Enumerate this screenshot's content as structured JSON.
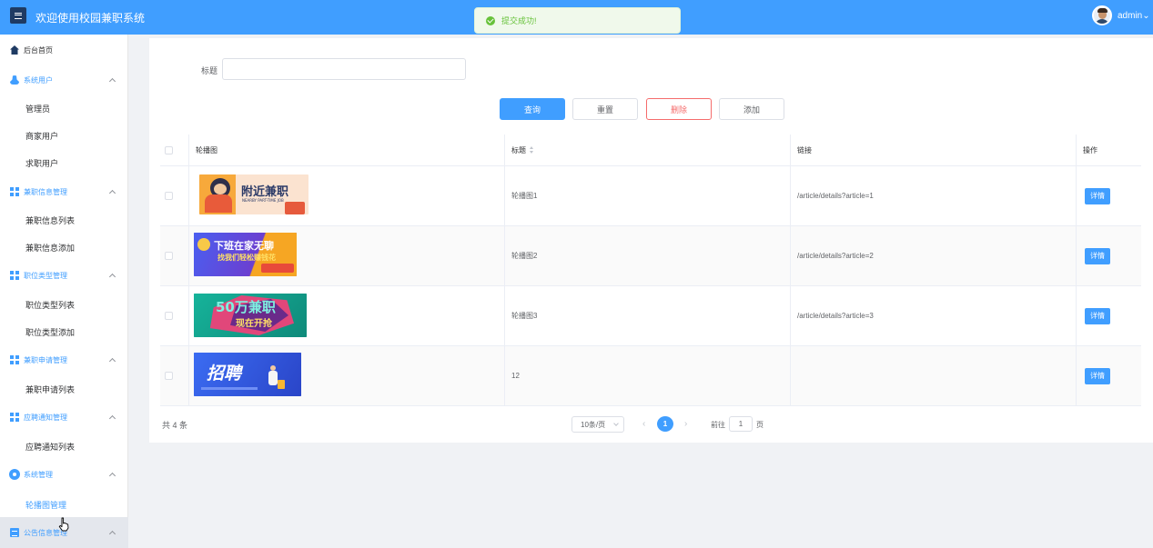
{
  "header": {
    "title": "欢迎使用校园兼职系统",
    "username": "admin",
    "username_caret": "⌄"
  },
  "toast": {
    "message": "提交成功!"
  },
  "sidebar": {
    "home": "后台首页",
    "groups": [
      {
        "label": "系统用户",
        "icon": "user-icon",
        "items": [
          "管理员",
          "商家用户",
          "求职用户"
        ]
      },
      {
        "label": "兼职信息管理",
        "icon": "grid-icon",
        "items": [
          "兼职信息列表",
          "兼职信息添加"
        ]
      },
      {
        "label": "职位类型管理",
        "icon": "grid-icon",
        "items": [
          "职位类型列表",
          "职位类型添加"
        ]
      },
      {
        "label": "兼职申请管理",
        "icon": "grid-icon",
        "items": [
          "兼职申请列表"
        ]
      },
      {
        "label": "应聘通知管理",
        "icon": "grid-icon",
        "items": [
          "应聘通知列表"
        ]
      },
      {
        "label": "系统管理",
        "icon": "gear-icon",
        "items": [
          "轮播图管理"
        ]
      },
      {
        "label": "公告信息管理",
        "icon": "doc-icon",
        "items": []
      }
    ],
    "active_item": "轮播图管理",
    "accent": "#409eff"
  },
  "search": {
    "label": "标题",
    "value": "",
    "placeholder": ""
  },
  "buttons": {
    "query": "查询",
    "reset": "重置",
    "delete": "删除",
    "add": "添加"
  },
  "table": {
    "columns": [
      "轮播图",
      "标题",
      "链接",
      "操作"
    ],
    "rows": [
      {
        "banner_text": "附近兼职",
        "banner_sub": "NEARBY PART-TIME JOB",
        "title": "轮播图1",
        "link": "/article/details?article=1",
        "action": "详情"
      },
      {
        "banner_text": "下班在家无聊",
        "banner_sub": "找我们轻松赚钱花",
        "title": "轮播图2",
        "link": "/article/details?article=2",
        "action": "详情"
      },
      {
        "banner_text": "50万兼职",
        "banner_sub": "现在开抢",
        "title": "轮播图3",
        "link": "/article/details?article=3",
        "action": "详情"
      },
      {
        "banner_text": "招聘",
        "banner_sub": "",
        "title": "12",
        "link": "",
        "action": "详情"
      }
    ]
  },
  "pagination": {
    "total": "共 4 条",
    "page_size": "10条/页",
    "current_page": "1",
    "goto_label": "前往",
    "goto_value": "1",
    "goto_suffix": "页"
  },
  "colors": {
    "primary": "#409eff",
    "danger": "#f56c6c",
    "success": "#67c23a"
  }
}
